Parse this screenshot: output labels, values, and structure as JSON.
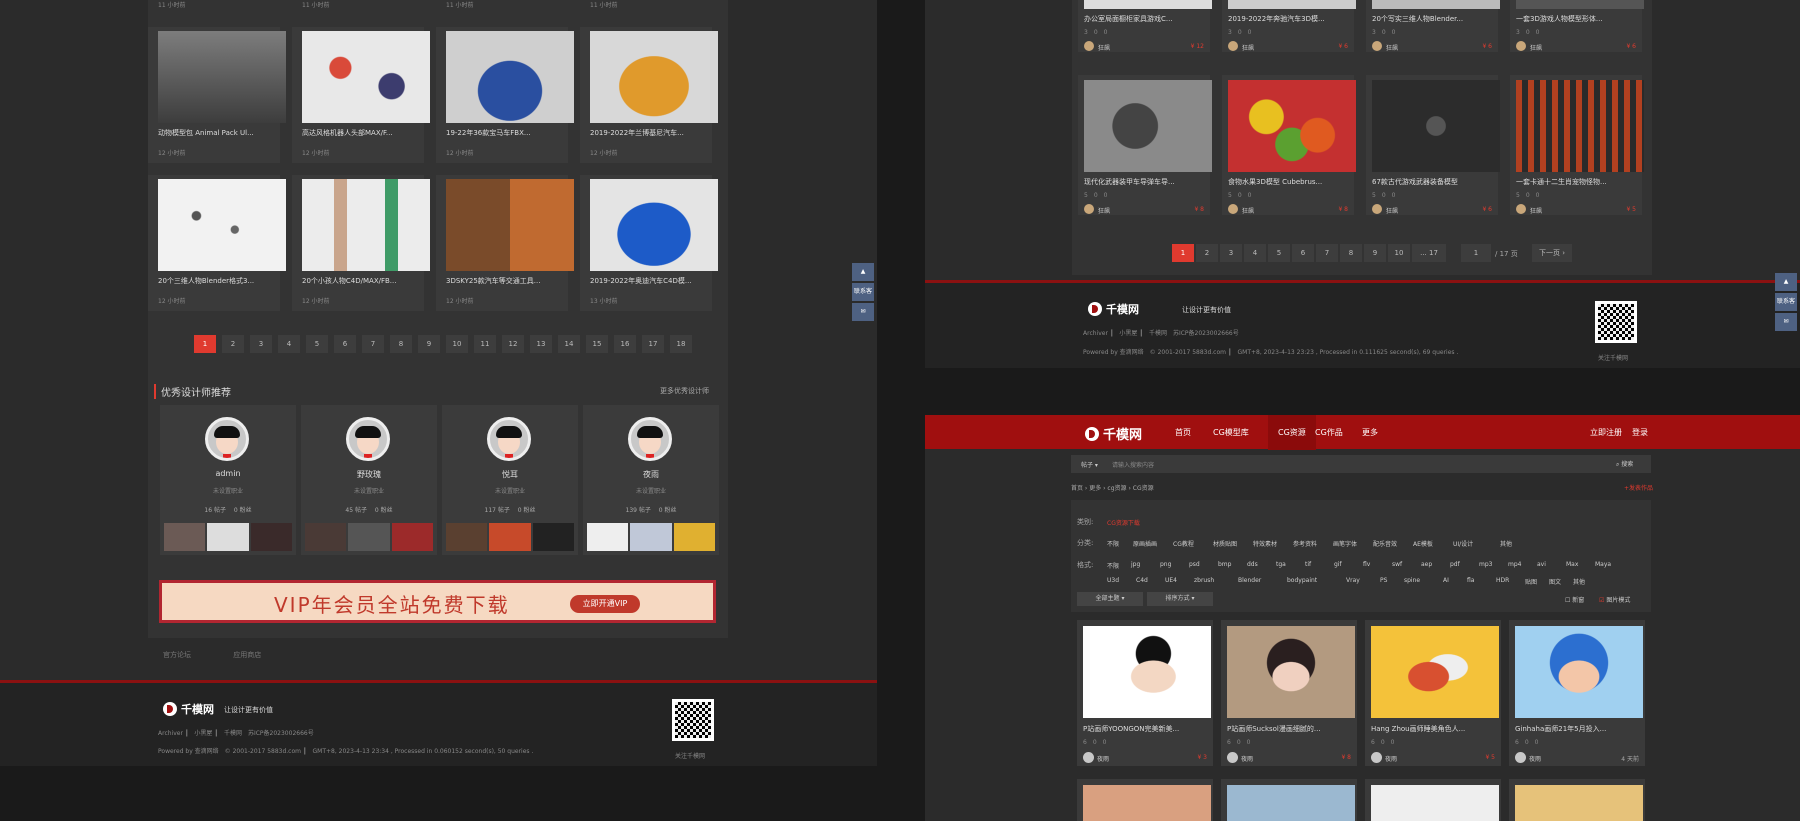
{
  "left": {
    "top_times": [
      "11 小时前",
      "11 小时前",
      "11 小时前",
      "11 小时前"
    ],
    "cards": [
      {
        "title": "动物模型包 Animal Pack Ul...",
        "time": "12 小时前"
      },
      {
        "title": "高达风格机器人头部MAX/F...",
        "time": "12 小时前"
      },
      {
        "title": "19-22年36款宝马车FBX...",
        "time": "12 小时前"
      },
      {
        "title": "2019-2022年兰博基尼汽车...",
        "time": "12 小时前"
      },
      {
        "title": "20个三维人物Blender格式3...",
        "time": "12 小时前"
      },
      {
        "title": "20个小孩人物C4D/MAX/FB...",
        "time": "12 小时前"
      },
      {
        "title": "3DSKY25款汽车等交通工具...",
        "time": "12 小时前"
      },
      {
        "title": "2019-2022年奥迪汽车C4D模...",
        "time": "13 小时前"
      }
    ],
    "pages": [
      "1",
      "2",
      "3",
      "4",
      "5",
      "6",
      "7",
      "8",
      "9",
      "10",
      "11",
      "12",
      "13",
      "14",
      "15",
      "16",
      "17",
      "18"
    ],
    "section_title": "优秀设计师推荐",
    "more_designers": "更多优秀设计师",
    "designers": [
      {
        "name": "admin",
        "sub": "未设置职业",
        "stats": "16 帖子　 0 粉丝"
      },
      {
        "name": "野玫瑰",
        "sub": "未设置职业",
        "stats": "45 帖子　 0 粉丝"
      },
      {
        "name": "悦耳",
        "sub": "未设置职业",
        "stats": "117 帖子　 0 粉丝"
      },
      {
        "name": "夜雨",
        "sub": "未设置职业",
        "stats": "139 帖子　 0 粉丝"
      }
    ],
    "vip_text": "VIP年会员全站免费下载",
    "vip_button": "立即开通VIP",
    "foot_links": [
      "官方论坛",
      "应用商店"
    ]
  },
  "footer": {
    "logo": "千模网",
    "slogan": "让设计更有价值",
    "links": "Archiver ┃　小黑屋 ┃　千模网　苏ICP备2023002666号",
    "powered_left": "Powered by 查滴网络　© 2001-2017 5883d.com ┃　GMT+8, 2023-4-13 23:34 , Processed in 0.060152 second(s), 50 queries .",
    "powered_right": "Powered by 查滴网络　© 2001-2017 5883d.com ┃　GMT+8, 2023-4-13 23:23 , Processed in 0.111625 second(s), 69 queries .",
    "qr_caption": "关注千模网"
  },
  "side_tools": {
    "top": "▲",
    "service": "联系客服",
    "mail": "✉"
  },
  "right_top": {
    "top_titles": [
      "办公室局面橱柜家具游戏C...",
      "2019-2022年奔驰汽车3D模...",
      "20个写实三维人物Blender...",
      "一套3D游戏人物模型形体..."
    ],
    "top_prices": [
      "¥ 12",
      "¥ 6",
      "¥ 6",
      "¥ 6"
    ],
    "cards": [
      {
        "title": "现代化武器装甲车导弹车导...",
        "meta": "5　0　0",
        "user": "狂飙",
        "price": "¥ 8"
      },
      {
        "title": "食物水果3D模型 Cubebrus...",
        "meta": "5　0　0",
        "user": "狂飙",
        "price": "¥ 8"
      },
      {
        "title": "67款古代游戏武器装备模型",
        "meta": "5　0　0",
        "user": "狂飙",
        "price": "¥ 6"
      },
      {
        "title": "一套卡通十二生肖宠物怪物...",
        "meta": "5　0　0",
        "user": "狂飙",
        "price": "¥ 5"
      }
    ],
    "top_meta": "3　0　0",
    "top_user": "狂飙",
    "pages": [
      "1",
      "2",
      "3",
      "4",
      "5",
      "6",
      "7",
      "8",
      "9",
      "10",
      "... 17"
    ],
    "page_input": "1",
    "page_total": "/ 17 页",
    "next": "下一页 ›"
  },
  "right_bottom": {
    "nav": [
      "首页",
      "CG模型库",
      "CG资源",
      "CG作品",
      "更多"
    ],
    "register": "立即注册",
    "login": "登录",
    "search_type": "帖子 ▾",
    "search_placeholder": "请输入搜索内容",
    "search_button": "搜索",
    "breadcrumb": "首页 › 更多 › cg资源 › CG资源",
    "post_link": "+发表作品",
    "category_label": "类别:",
    "category_value": "CG资源下载",
    "class_label": "分类:",
    "classes": [
      "不限",
      "原画插画",
      "CG教程",
      "材质贴图",
      "特效素材",
      "参考资料",
      "画笔字体",
      "配乐音效",
      "AE模板",
      "UI/设计",
      "其他"
    ],
    "format_label": "格式:",
    "formats": [
      "不限",
      "jpg",
      "png",
      "psd",
      "bmp",
      "dds",
      "tga",
      "tif",
      "gif",
      "flv",
      "swf",
      "aep",
      "pdf",
      "mp3",
      "mp4",
      "avi",
      "Max",
      "Maya",
      "U3d",
      "C4d",
      "UE4",
      "zbrush",
      "Blender",
      "bodypaint",
      "Vray",
      "PS",
      "spine",
      "AI",
      "fla",
      "HDR",
      "贴图",
      "图文",
      "其他"
    ],
    "all_topics": "全部主题 ▾",
    "sort": "排序方式 ▾",
    "newest": "新窗",
    "image_mode": "图片模式",
    "cards": [
      {
        "title": "P站画师YOONGON完美新美...",
        "meta": "6　0　0",
        "user": "夜雨",
        "price": "¥ 3"
      },
      {
        "title": "P站画师Sucksol漫画细腻的...",
        "meta": "6　0　0",
        "user": "夜雨",
        "price": "¥ 8"
      },
      {
        "title": "Hang Zhou画师睡美角色人...",
        "meta": "6　0　0",
        "user": "夜雨",
        "price": "¥ 5"
      },
      {
        "title": "Ginhaha画师21年5月投入...",
        "meta": "6　0　0",
        "user": "夜雨",
        "price": "4 天前"
      }
    ]
  },
  "colors": {
    "accent": "#e03a2f",
    "nav_red": "#a00f0f",
    "side_blue": "#4e6182"
  }
}
